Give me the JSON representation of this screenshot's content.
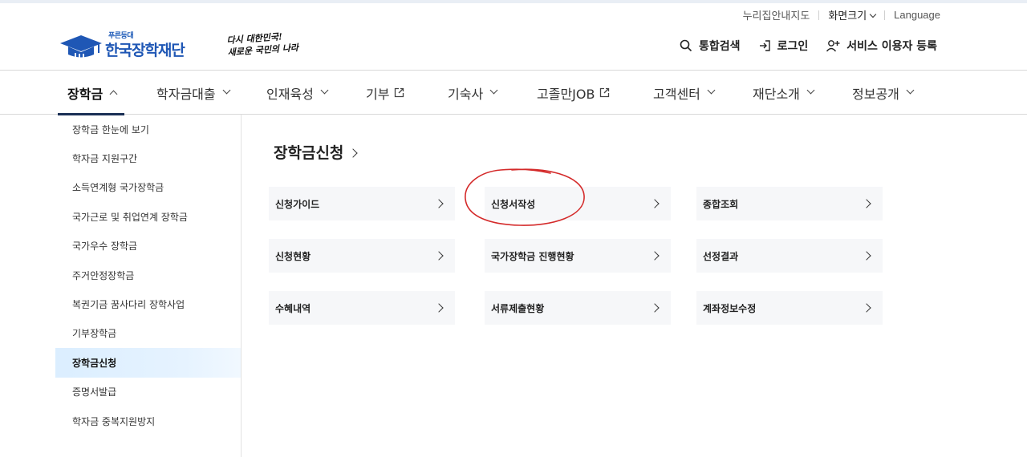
{
  "utility": {
    "sitemap": "누리집안내지도",
    "font_size": "화면크기",
    "language": "Language"
  },
  "logo": {
    "small": "푸른등대",
    "main": "한국장학재단",
    "slogan_line1": "다시 대한민국!",
    "slogan_line2": "새로운 국민의 나라"
  },
  "header_links": {
    "search": "통합검색",
    "login": "로그인",
    "register": "서비스 이용자 등록"
  },
  "gnb": [
    {
      "label": "장학금",
      "icon": "chevron-up-icon"
    },
    {
      "label": "학자금대출",
      "icon": "chevron-down-icon"
    },
    {
      "label": "인재육성",
      "icon": "chevron-down-icon"
    },
    {
      "label": "기부",
      "icon": "external-link-icon"
    },
    {
      "label": "기숙사",
      "icon": "chevron-down-icon"
    },
    {
      "label": "고졸만JOB",
      "icon": "external-link-icon"
    },
    {
      "label": "고객센터",
      "icon": "chevron-down-icon"
    },
    {
      "label": "재단소개",
      "icon": "chevron-down-icon"
    },
    {
      "label": "정보공개",
      "icon": "chevron-down-icon"
    }
  ],
  "sidebar": {
    "items": [
      {
        "label": "장학금 한눈에 보기"
      },
      {
        "label": "학자금 지원구간"
      },
      {
        "label": "소득연계형 국가장학금"
      },
      {
        "label": "국가근로 및 취업연계 장학금"
      },
      {
        "label": "국가우수 장학금"
      },
      {
        "label": "주거안정장학금"
      },
      {
        "label": "복권기금 꿈사다리 장학사업"
      },
      {
        "label": "기부장학금"
      },
      {
        "label": "장학금신청"
      },
      {
        "label": "증명서발급"
      },
      {
        "label": "학자금 중복지원방지"
      }
    ],
    "active": "장학금신청"
  },
  "main": {
    "title": "장학금신청",
    "cards": [
      {
        "label": "신청가이드"
      },
      {
        "label": "신청서작성"
      },
      {
        "label": "종합조회"
      },
      {
        "label": "신청현황"
      },
      {
        "label": "국가장학금 진행현황"
      },
      {
        "label": "선정결과"
      },
      {
        "label": "수혜내역"
      },
      {
        "label": "서류제출현황"
      },
      {
        "label": "계좌정보수정"
      }
    ]
  },
  "colors": {
    "brand_blue": "#1f57b5",
    "nav_underline": "#1a2f55",
    "active_bg": "#dbeeff",
    "card_bg": "#f6f7f9",
    "annotation_red": "#d42a2a"
  }
}
